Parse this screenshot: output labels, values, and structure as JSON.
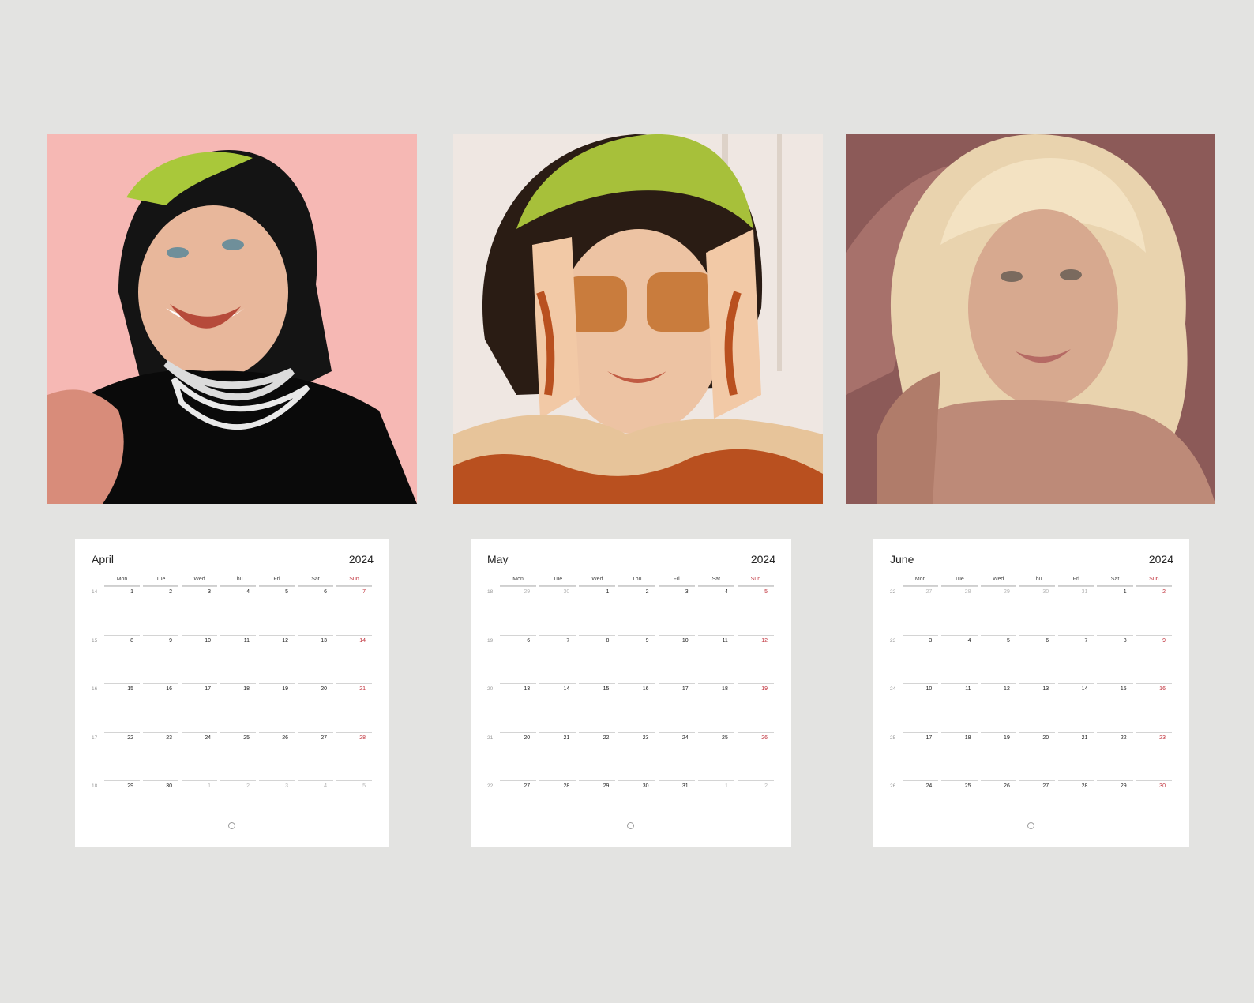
{
  "weekday_labels": [
    "Mon",
    "Tue",
    "Wed",
    "Thu",
    "Fri",
    "Sat",
    "Sun"
  ],
  "artworks": [
    {
      "background": "#f6b8b4",
      "hair_top": "#a9c83a",
      "hair": "#141414",
      "skin": "#e8b79b",
      "top": "#0a0a0a"
    },
    {
      "background": "#efe7e2",
      "hair_top": "#a7c03a",
      "hair": "#2a1c14",
      "skin": "#edc3a3",
      "accent": "#b9501f"
    },
    {
      "background": "#8c5a58",
      "hair": "#e9d3ae",
      "skin": "#d7a98f",
      "accent": "#bd8a78"
    }
  ],
  "calendars": [
    {
      "month": "April",
      "year": "2024",
      "weeks": [
        {
          "num": "14",
          "days": [
            {
              "d": "1"
            },
            {
              "d": "2"
            },
            {
              "d": "3"
            },
            {
              "d": "4"
            },
            {
              "d": "5"
            },
            {
              "d": "6"
            },
            {
              "d": "7"
            }
          ]
        },
        {
          "num": "15",
          "days": [
            {
              "d": "8"
            },
            {
              "d": "9"
            },
            {
              "d": "10"
            },
            {
              "d": "11"
            },
            {
              "d": "12"
            },
            {
              "d": "13"
            },
            {
              "d": "14"
            }
          ]
        },
        {
          "num": "16",
          "days": [
            {
              "d": "15"
            },
            {
              "d": "16"
            },
            {
              "d": "17"
            },
            {
              "d": "18"
            },
            {
              "d": "19"
            },
            {
              "d": "20"
            },
            {
              "d": "21"
            }
          ]
        },
        {
          "num": "17",
          "days": [
            {
              "d": "22"
            },
            {
              "d": "23"
            },
            {
              "d": "24"
            },
            {
              "d": "25"
            },
            {
              "d": "26"
            },
            {
              "d": "27"
            },
            {
              "d": "28"
            }
          ]
        },
        {
          "num": "18",
          "days": [
            {
              "d": "29"
            },
            {
              "d": "30"
            },
            {
              "d": "1",
              "muted": true
            },
            {
              "d": "2",
              "muted": true
            },
            {
              "d": "3",
              "muted": true
            },
            {
              "d": "4",
              "muted": true
            },
            {
              "d": "5",
              "muted": true
            }
          ]
        }
      ]
    },
    {
      "month": "May",
      "year": "2024",
      "weeks": [
        {
          "num": "18",
          "days": [
            {
              "d": "29",
              "muted": true
            },
            {
              "d": "30",
              "muted": true
            },
            {
              "d": "1"
            },
            {
              "d": "2"
            },
            {
              "d": "3"
            },
            {
              "d": "4"
            },
            {
              "d": "5"
            }
          ]
        },
        {
          "num": "19",
          "days": [
            {
              "d": "6"
            },
            {
              "d": "7"
            },
            {
              "d": "8"
            },
            {
              "d": "9"
            },
            {
              "d": "10"
            },
            {
              "d": "11"
            },
            {
              "d": "12"
            }
          ]
        },
        {
          "num": "20",
          "days": [
            {
              "d": "13"
            },
            {
              "d": "14"
            },
            {
              "d": "15"
            },
            {
              "d": "16"
            },
            {
              "d": "17"
            },
            {
              "d": "18"
            },
            {
              "d": "19"
            }
          ]
        },
        {
          "num": "21",
          "days": [
            {
              "d": "20"
            },
            {
              "d": "21"
            },
            {
              "d": "22"
            },
            {
              "d": "23"
            },
            {
              "d": "24"
            },
            {
              "d": "25"
            },
            {
              "d": "26"
            }
          ]
        },
        {
          "num": "22",
          "days": [
            {
              "d": "27"
            },
            {
              "d": "28"
            },
            {
              "d": "29"
            },
            {
              "d": "30"
            },
            {
              "d": "31"
            },
            {
              "d": "1",
              "muted": true
            },
            {
              "d": "2",
              "muted": true
            }
          ]
        }
      ]
    },
    {
      "month": "June",
      "year": "2024",
      "weeks": [
        {
          "num": "22",
          "days": [
            {
              "d": "27",
              "muted": true
            },
            {
              "d": "28",
              "muted": true
            },
            {
              "d": "29",
              "muted": true
            },
            {
              "d": "30",
              "muted": true
            },
            {
              "d": "31",
              "muted": true
            },
            {
              "d": "1"
            },
            {
              "d": "2"
            }
          ]
        },
        {
          "num": "23",
          "days": [
            {
              "d": "3"
            },
            {
              "d": "4"
            },
            {
              "d": "5"
            },
            {
              "d": "6"
            },
            {
              "d": "7"
            },
            {
              "d": "8"
            },
            {
              "d": "9"
            }
          ]
        },
        {
          "num": "24",
          "days": [
            {
              "d": "10"
            },
            {
              "d": "11"
            },
            {
              "d": "12"
            },
            {
              "d": "13"
            },
            {
              "d": "14"
            },
            {
              "d": "15"
            },
            {
              "d": "16"
            }
          ]
        },
        {
          "num": "25",
          "days": [
            {
              "d": "17"
            },
            {
              "d": "18"
            },
            {
              "d": "19"
            },
            {
              "d": "20"
            },
            {
              "d": "21"
            },
            {
              "d": "22"
            },
            {
              "d": "23"
            }
          ]
        },
        {
          "num": "26",
          "days": [
            {
              "d": "24"
            },
            {
              "d": "25"
            },
            {
              "d": "26"
            },
            {
              "d": "27"
            },
            {
              "d": "28"
            },
            {
              "d": "29"
            },
            {
              "d": "30"
            }
          ]
        }
      ]
    }
  ]
}
